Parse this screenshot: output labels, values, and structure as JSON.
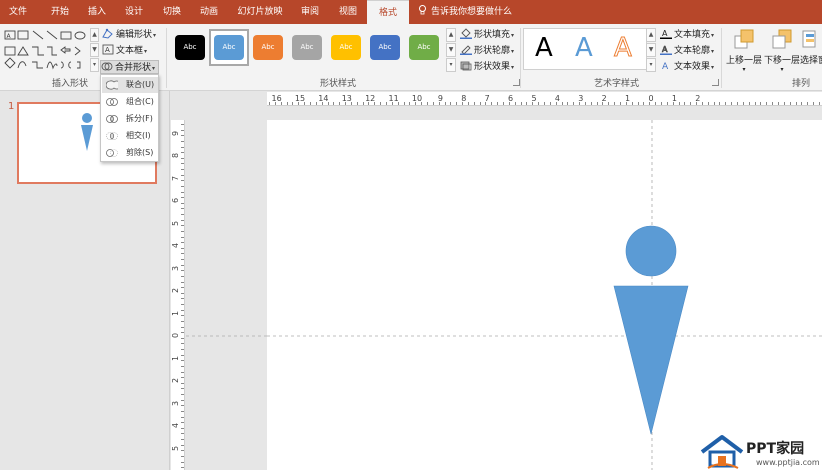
{
  "tabs": [
    "文件",
    "开始",
    "插入",
    "设计",
    "切换",
    "动画",
    "幻灯片放映",
    "审阅",
    "视图",
    "格式"
  ],
  "active_tab": "格式",
  "tell_me": "告诉我你想要做什么",
  "ribbon": {
    "insert_shapes": {
      "label": "插入形状",
      "edit_shape": "编辑形状",
      "text_box": "文本框",
      "merge_shapes": "合并形状"
    },
    "shape_styles": {
      "label": "形状样式",
      "style_text": "Abc",
      "fill": "形状填充",
      "outline": "形状轮廓",
      "effects": "形状效果",
      "colors": [
        "#000000",
        "#5b9bd5",
        "#ed7d31",
        "#a5a5a5",
        "#ffc000",
        "#4472c4",
        "#70ad47"
      ]
    },
    "wordart": {
      "label": "艺术字样式",
      "letter": "A",
      "text_fill": "文本填充",
      "text_outline": "文本轮廓",
      "text_effects": "文本效果"
    },
    "arrange": {
      "label": "排列",
      "bring_forward": "上移一层",
      "send_backward": "下移一层",
      "selection_pane": "选择窗"
    }
  },
  "merge_menu": {
    "items": [
      "联合(U)",
      "组合(C)",
      "拆分(F)",
      "相交(I)",
      "剪除(S)"
    ],
    "highlighted": 0
  },
  "slide_panel": {
    "slide_number": "1"
  },
  "ruler": {
    "h_labels": [
      "16",
      "15",
      "14",
      "13",
      "12",
      "11",
      "10",
      "9",
      "8",
      "7",
      "6",
      "5",
      "4",
      "3",
      "2",
      "1",
      "0",
      "1",
      "2"
    ],
    "v_labels": [
      "9",
      "8",
      "7",
      "6",
      "5",
      "4",
      "3",
      "2",
      "1",
      "0",
      "1",
      "2",
      "3",
      "4",
      "5"
    ]
  },
  "colors": {
    "accent": "#b7472a",
    "shape_fill": "#5b9bd5"
  },
  "watermark": {
    "title": "PPT家园",
    "url": "www.pptjia.com"
  }
}
